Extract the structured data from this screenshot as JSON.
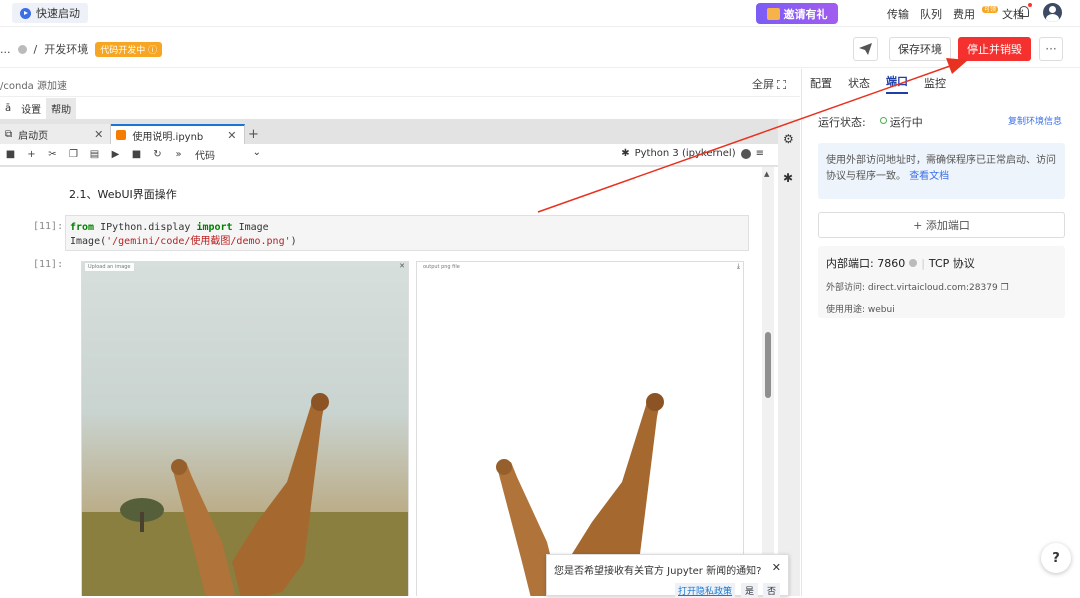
{
  "topbar": {
    "quick_start": "快速启动",
    "invite": "邀请有礼",
    "nav": [
      "传输",
      "队列",
      "费用",
      "文档"
    ],
    "fee_badge": "可领"
  },
  "bar2": {
    "breadcrumb_prefix": "...",
    "separator": "/",
    "env_name": "开发环境",
    "dev_tag": "代码开发中 ⓘ",
    "save_env": "保存环境",
    "stop_destroy": "停止并销毁",
    "more": "···"
  },
  "left": {
    "conda": "/conda 源加速",
    "fullscreen": "全屏",
    "menus": [
      "ā",
      "设置",
      "帮助"
    ]
  },
  "jupyter": {
    "tabs": [
      {
        "label": "启动页",
        "close": "✕"
      },
      {
        "label": "使用说明.ipynb",
        "close": "✕"
      }
    ],
    "tab_add": "+",
    "cell_type": "代码",
    "cell_type_caret": "⌄",
    "kernel": "Python 3 (ipykernel)",
    "heading": "2.1、WebUI界面操作",
    "prompt_in": "[11]:",
    "prompt_out": "[11]:",
    "code": {
      "from": "from",
      "module": " IPython.display ",
      "import": "import",
      "name": " Image",
      "call_pre": "Image(",
      "call_str": "'/gemini/code/使用截图/demo.png'",
      "call_post": ")"
    },
    "left_panel_label": "Upload an image",
    "right_panel_label": "output png file"
  },
  "notification": {
    "message": "您是否希望接收有关官方 Jupyter 新闻的通知?",
    "close": "✕",
    "privacy": "打开隐私政策",
    "yes": "是",
    "no": "否"
  },
  "right": {
    "tabs": [
      "配置",
      "状态",
      "端口",
      "监控"
    ],
    "status_label": "运行状态:",
    "status_value": "运行中",
    "copy_env": "复制环境信息",
    "notice": "使用外部访问地址时，需确保程序已正常启动、访问协议与程序一致。",
    "doc_link": "查看文档",
    "add_port": "+ 添加端口",
    "port_internal": "内部端口: 7860",
    "port_protocol": "TCP 协议",
    "external": "外部访问: direct.virtaicloud.com:28379",
    "usage": "使用用途: webui"
  },
  "help": "?",
  "colors": {
    "accent": "#3b6fe8",
    "stop": "#f5312f",
    "arrow": "#e8311f"
  }
}
